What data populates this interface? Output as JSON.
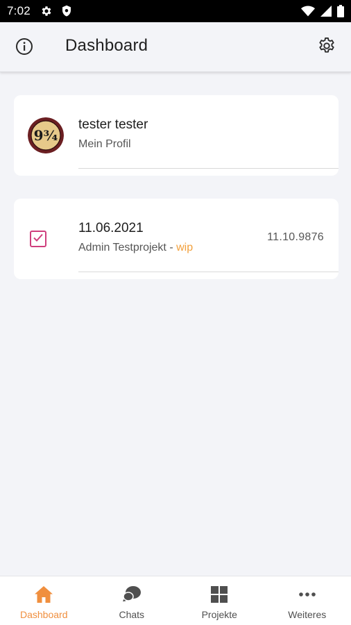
{
  "status_bar": {
    "time": "7:02",
    "icons": [
      "gear-icon",
      "shield-icon",
      "wifi-icon",
      "signal-icon",
      "battery-icon"
    ]
  },
  "app_bar": {
    "title": "Dashboard",
    "left_icon": "info-icon",
    "right_icon": "settings-icon"
  },
  "profile_card": {
    "name": "tester tester",
    "subtitle": "Mein Profil",
    "avatar_text": "9¾"
  },
  "task_card": {
    "date": "11.06.2021",
    "project": "Admin Testprojekt - ",
    "status": "wip",
    "right_date": "11.10.9876",
    "checked": true
  },
  "bottom_nav": {
    "items": [
      {
        "label": "Dashboard",
        "icon": "home-icon",
        "active": true
      },
      {
        "label": "Chats",
        "icon": "chat-bubbles-icon",
        "active": false
      },
      {
        "label": "Projekte",
        "icon": "grid-icon",
        "active": false
      },
      {
        "label": "Weiteres",
        "icon": "more-dots-icon",
        "active": false
      }
    ]
  },
  "colors": {
    "accent": "#f08f3e",
    "checkbox": "#cf3f7d",
    "background": "#f3f4f8",
    "wip": "#f2a03c"
  }
}
